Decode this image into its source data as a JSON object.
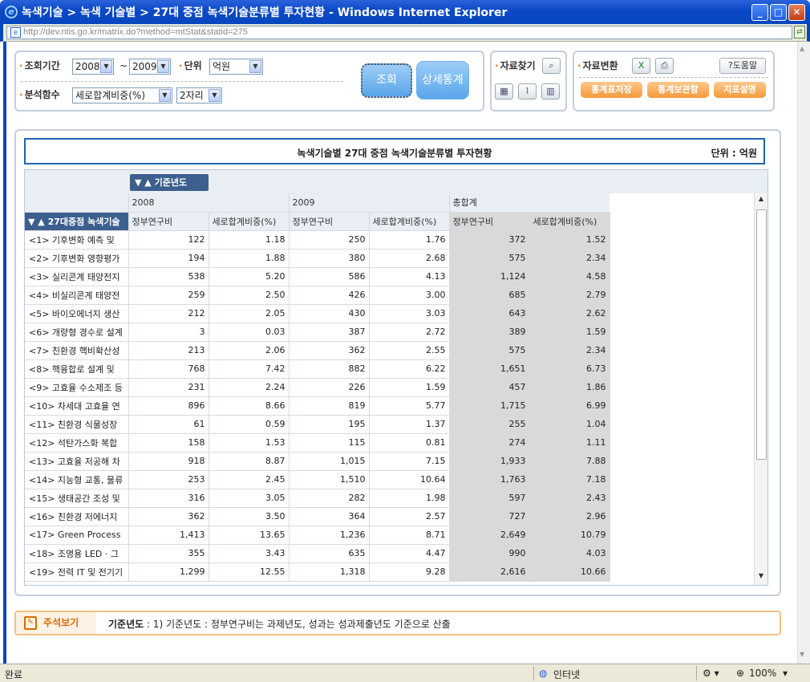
{
  "window": {
    "title": "녹색기술 > 녹색 기술별 > 27대 중점 녹색기술분류별 투자현황 - Windows Internet Explorer"
  },
  "address": {
    "url": "http://dev.ntis.go.kr/matrix.do?method=mtStat&statid=275"
  },
  "controls": {
    "period_label": "조회기간",
    "year_from": "2008",
    "tilde": "~",
    "year_to": "2009",
    "unit_label": "단위",
    "unit_value": "억원",
    "func_label": "분석함수",
    "func_value": "세로합계비중(%)",
    "digits_value": "2자리",
    "search_button": "조회",
    "detail_button": "상세통계",
    "find_label": "자료찾기",
    "convert_label": "자료변환",
    "help_button": "도움말",
    "save_table_button": "통계표저장",
    "storage_button": "통계보관함",
    "indicator_button": "지표설명"
  },
  "table": {
    "caption": "녹색기술별 27대 중점 녹색기술분류별 투자현황",
    "unit": "단위 : 억원",
    "col_dim": "기준년도",
    "row_dim": "27대중점 녹색기술",
    "years": [
      "2008",
      "2009",
      "총합계"
    ],
    "measures": [
      "정부연구비",
      "세로합계비중(%)",
      "정부연구비",
      "세로합계비중(%)",
      "정부연구비",
      "세로합계비중(%)"
    ],
    "rows": [
      {
        "label": "<1> 기후변화 예측 및",
        "v": [
          "122",
          "1.18",
          "250",
          "1.76",
          "372",
          "1.52"
        ]
      },
      {
        "label": "<2> 기후변화 영향평가",
        "v": [
          "194",
          "1.88",
          "380",
          "2.68",
          "575",
          "2.34"
        ]
      },
      {
        "label": "<3> 실리콘계 태양전지",
        "v": [
          "538",
          "5.20",
          "586",
          "4.13",
          "1,124",
          "4.58"
        ]
      },
      {
        "label": "<4> 비실리콘계 태양전",
        "v": [
          "259",
          "2.50",
          "426",
          "3.00",
          "685",
          "2.79"
        ]
      },
      {
        "label": "<5> 바이오에너지 생산",
        "v": [
          "212",
          "2.05",
          "430",
          "3.03",
          "643",
          "2.62"
        ]
      },
      {
        "label": "<6> 개량형 경수로 설계",
        "v": [
          "3",
          "0.03",
          "387",
          "2.72",
          "389",
          "1.59"
        ]
      },
      {
        "label": "<7> 친환경 핵비확산성",
        "v": [
          "213",
          "2.06",
          "362",
          "2.55",
          "575",
          "2.34"
        ]
      },
      {
        "label": "<8> 핵융합로 설계 및",
        "v": [
          "768",
          "7.42",
          "882",
          "6.22",
          "1,651",
          "6.73"
        ]
      },
      {
        "label": "<9> 고효율 수소제조 등",
        "v": [
          "231",
          "2.24",
          "226",
          "1.59",
          "457",
          "1.86"
        ]
      },
      {
        "label": "<10> 차세대 고효율 연",
        "v": [
          "896",
          "8.66",
          "819",
          "5.77",
          "1,715",
          "6.99"
        ]
      },
      {
        "label": "<11> 친환경 식물성장",
        "v": [
          "61",
          "0.59",
          "195",
          "1.37",
          "255",
          "1.04"
        ]
      },
      {
        "label": "<12> 석탄가스화 복합",
        "v": [
          "158",
          "1.53",
          "115",
          "0.81",
          "274",
          "1.11"
        ]
      },
      {
        "label": "<13> 고효율 저공해 차",
        "v": [
          "918",
          "8.87",
          "1,015",
          "7.15",
          "1,933",
          "7.88"
        ]
      },
      {
        "label": "<14> 지능형 교통, 물류",
        "v": [
          "253",
          "2.45",
          "1,510",
          "10.64",
          "1,763",
          "7.18"
        ]
      },
      {
        "label": "<15> 생태공간 조성 및",
        "v": [
          "316",
          "3.05",
          "282",
          "1.98",
          "597",
          "2.43"
        ]
      },
      {
        "label": "<16> 친환경 저에너지",
        "v": [
          "362",
          "3.50",
          "364",
          "2.57",
          "727",
          "2.96"
        ]
      },
      {
        "label": "<17> Green Process",
        "v": [
          "1,413",
          "13.65",
          "1,236",
          "8.71",
          "2,649",
          "10.79"
        ]
      },
      {
        "label": "<18> 조명용 LED · 그",
        "v": [
          "355",
          "3.43",
          "635",
          "4.47",
          "990",
          "4.03"
        ]
      },
      {
        "label": "<19> 전력 IT 및 전기기",
        "v": [
          "1,299",
          "12.55",
          "1,318",
          "9.28",
          "2,616",
          "10.66"
        ]
      }
    ]
  },
  "note": {
    "title": "주석보기",
    "label": "기준년도",
    "text": ": 1) 기준년도 : 정부연구비는 과제년도, 성과는 성과제출년도 기준으로 산출"
  },
  "status": {
    "left": "완료",
    "zone": "인터넷",
    "zoom": "100%"
  }
}
